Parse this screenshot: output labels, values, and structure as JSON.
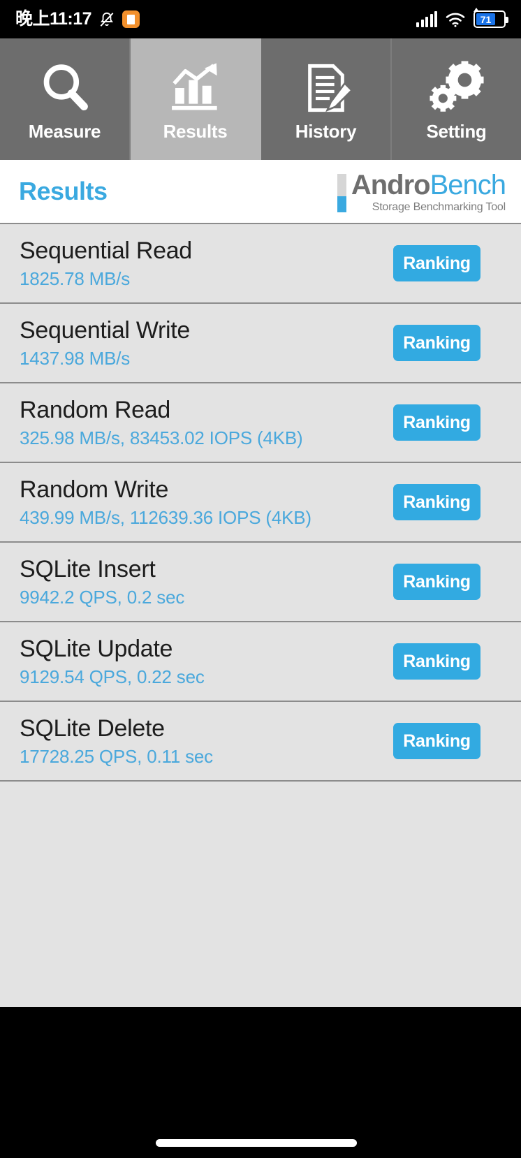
{
  "status_bar": {
    "clock": "晚上11:17",
    "mute_icon": "bell-mute-icon",
    "app_badge_icon": "note-app-icon",
    "signal_icon": "cellular-signal-icon",
    "wifi_icon": "wifi-icon",
    "battery_icon": "battery-icon",
    "battery_level": "71"
  },
  "tabs": [
    {
      "label": "Measure",
      "icon": "magnifier-icon",
      "selected": false
    },
    {
      "label": "Results",
      "icon": "bar-chart-arrow-icon",
      "selected": true
    },
    {
      "label": "History",
      "icon": "document-pen-icon",
      "selected": false
    },
    {
      "label": "Setting",
      "icon": "gears-icon",
      "selected": false
    }
  ],
  "header": {
    "page_title": "Results",
    "brand_part1": "Andro",
    "brand_part2": "Bench",
    "tagline": "Storage Benchmarking Tool",
    "brand_gray": "#6e6e6e",
    "brand_blue": "#3aa9e0"
  },
  "results": {
    "button_label": "Ranking",
    "rows": [
      {
        "title": "Sequential Read",
        "value": "1825.78 MB/s"
      },
      {
        "title": "Sequential Write",
        "value": "1437.98 MB/s"
      },
      {
        "title": "Random Read",
        "value": "325.98 MB/s, 83453.02 IOPS (4KB)"
      },
      {
        "title": "Random Write",
        "value": "439.99 MB/s, 112639.36 IOPS (4KB)"
      },
      {
        "title": "SQLite Insert",
        "value": "9942.2 QPS, 0.2 sec"
      },
      {
        "title": "SQLite Update",
        "value": "9129.54 QPS, 0.22 sec"
      },
      {
        "title": "SQLite Delete",
        "value": "17728.25 QPS, 0.11 sec"
      }
    ]
  },
  "colors": {
    "accent_blue": "#32aae1",
    "value_blue": "#4aa8dc",
    "tab_bg": "#6d6d6d",
    "tab_selected_bg": "#b7b7b7",
    "list_bg": "#e3e3e3"
  },
  "navigation": {
    "gesture_pill": "home-gesture-pill"
  }
}
